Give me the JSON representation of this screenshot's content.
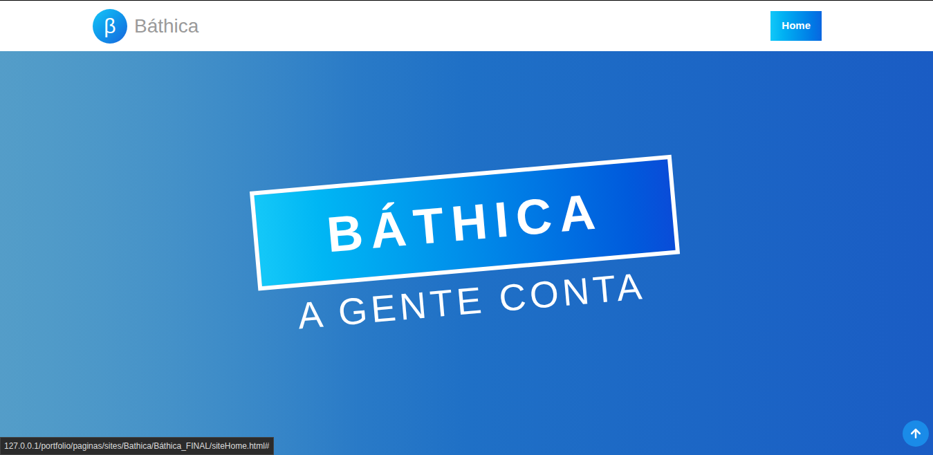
{
  "header": {
    "logo": {
      "glyph": "β",
      "name": "Báthica"
    },
    "nav": [
      {
        "label": "Home",
        "selected": true
      }
    ]
  },
  "hero": {
    "title": "BÁTHICA",
    "subtitle": "A GENTE CONTA"
  },
  "status_bar": {
    "url": "127.0.0.1/portfolio/paginas/sites/Bathica/Báthica_FINAL/siteHome.html#"
  }
}
